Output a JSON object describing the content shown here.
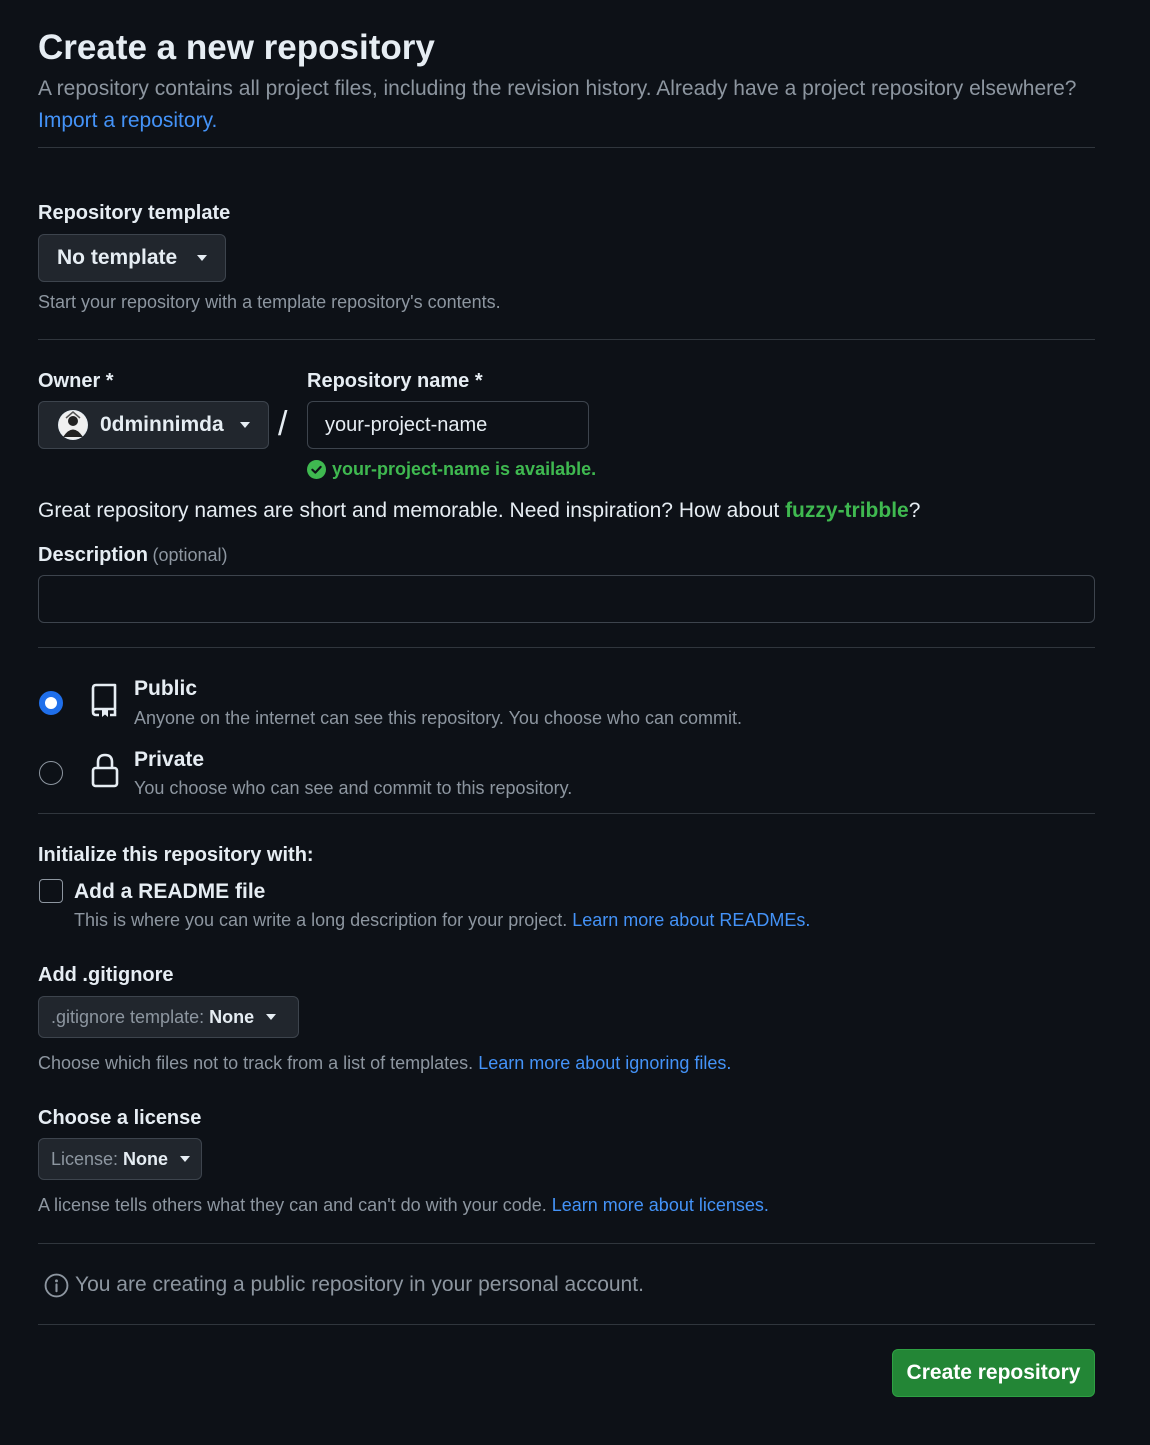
{
  "header": {
    "title": "Create a new repository",
    "subtitle": "A repository contains all project files, including the revision history. Already have a project repository elsewhere?",
    "import_link": "Import a repository."
  },
  "template": {
    "label": "Repository template",
    "button": "No template",
    "hint": "Start your repository with a template repository's contents."
  },
  "owner": {
    "label": "Owner *",
    "value": "0dminnimda",
    "separator": "/"
  },
  "repo_name": {
    "label": "Repository name *",
    "value": "your-project-name",
    "availability": "your-project-name is available.",
    "availability_color": "#3fb950"
  },
  "inspiration": {
    "text_before": "Great repository names are short and memorable. Need inspiration? How about ",
    "suggestion": "fuzzy-tribble",
    "text_after": "?"
  },
  "description": {
    "label": "Description",
    "optional": "(optional)",
    "value": ""
  },
  "visibility": {
    "public": {
      "label": "Public",
      "hint": "Anyone on the internet can see this repository. You choose who can commit.",
      "selected": true
    },
    "private": {
      "label": "Private",
      "hint": "You choose who can see and commit to this repository.",
      "selected": false
    }
  },
  "initialize": {
    "label": "Initialize this repository with:",
    "readme_label": "Add a README file",
    "readme_hint": "This is where you can write a long description for your project.",
    "readme_link": "Learn more about READMEs.",
    "readme_checked": false
  },
  "gitignore": {
    "label": "Add .gitignore",
    "prefix": ".gitignore template:",
    "value": "None",
    "hint": "Choose which files not to track from a list of templates.",
    "link": "Learn more about ignoring files."
  },
  "license": {
    "label": "Choose a license",
    "prefix": "License:",
    "value": "None",
    "hint": "A license tells others what they can and can't do with your code.",
    "link": "Learn more about licenses."
  },
  "notice": {
    "text": "You are creating a public repository in your personal account."
  },
  "submit": {
    "label": "Create repository",
    "color": "#238636"
  },
  "icons": {
    "public": "repo-icon",
    "private": "lock-icon",
    "check": "check-circle-icon",
    "info": "info-icon",
    "avatar": "avatar"
  }
}
